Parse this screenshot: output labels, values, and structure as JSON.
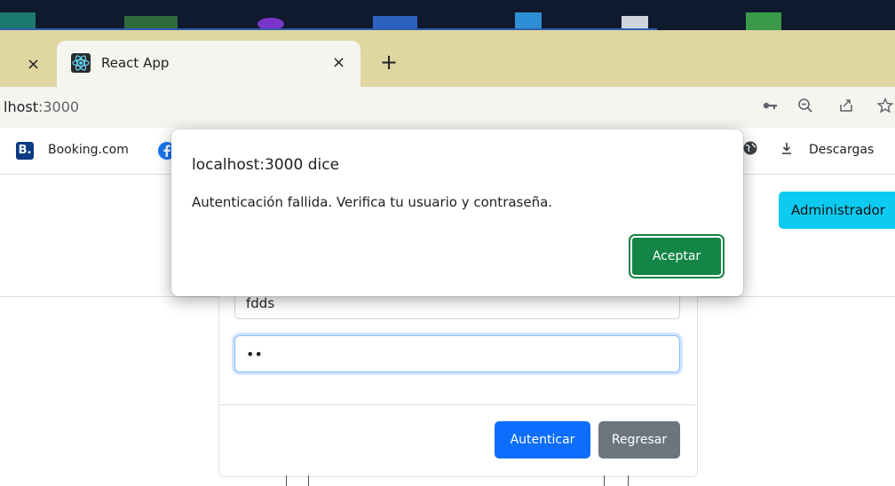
{
  "browser": {
    "tab_title": "React App",
    "tab_close_symbol": "×",
    "prev_tab_close_symbol": "×",
    "new_tab_symbol": "+",
    "url_host": "lhost",
    "url_port": ":3000",
    "icons": [
      "key-icon",
      "zoom-out-icon",
      "share-icon",
      "star-icon",
      "react-favicon",
      "booking-icon",
      "facebook-icon",
      "globe-icon",
      "download-icon"
    ]
  },
  "bookmarks": {
    "booking_label": "Booking.com",
    "booking_icon_letter": "B.",
    "downloads_label": "Descargas"
  },
  "page": {
    "admin_button": "Administrador",
    "username_value": "fdds",
    "password_value": "••",
    "auth_button": "Autenticar",
    "back_button": "Regresar"
  },
  "dialog": {
    "title": "localhost:3000 dice",
    "message": "Autenticación fallida. Verifica tu usuario y contraseña.",
    "accept_button": "Aceptar"
  },
  "colors": {
    "tabbar": "#dfd6a2",
    "accept_green": "#138546",
    "primary_blue": "#0d6efd",
    "info_cyan": "#0dcaf0",
    "secondary_gray": "#6c757d"
  }
}
